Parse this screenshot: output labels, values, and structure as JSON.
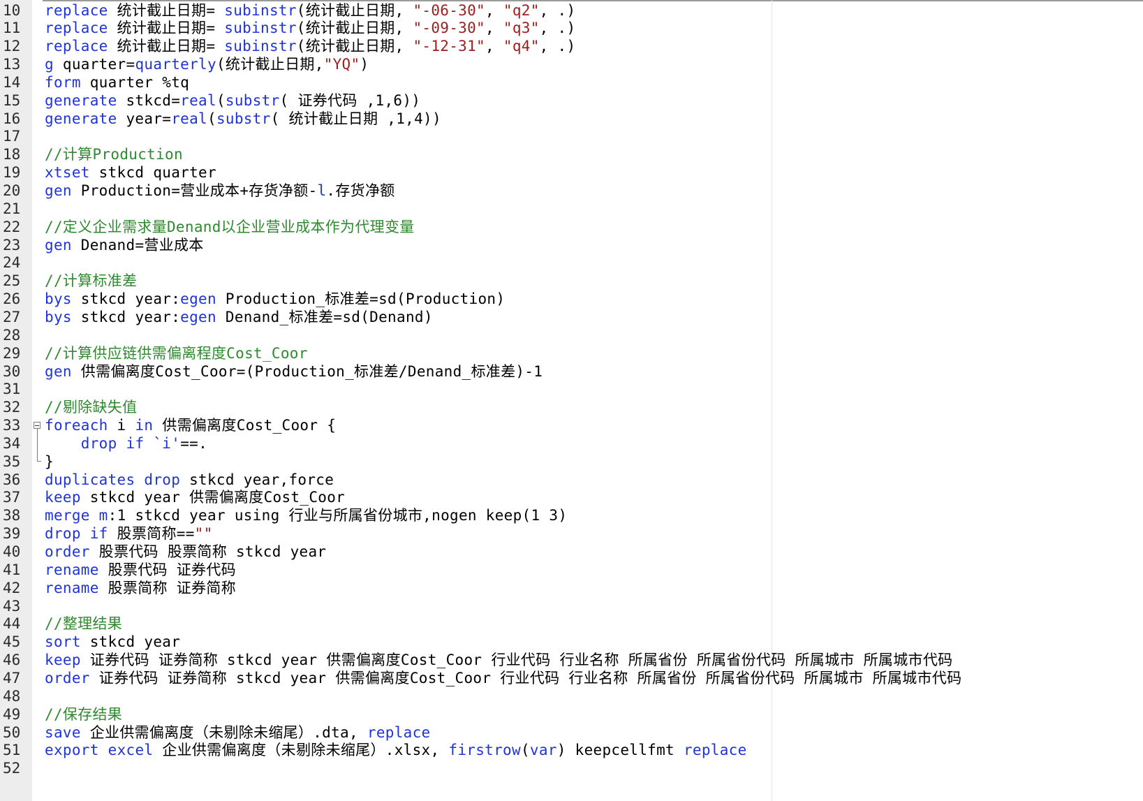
{
  "editor": {
    "first_line_number": 10,
    "lines": [
      {
        "n": "10",
        "tokens": [
          [
            "k",
            "replace"
          ],
          [
            "p",
            " 统计截止日期= "
          ],
          [
            "k",
            "subinstr"
          ],
          [
            "p",
            "(统计截止日期, "
          ],
          [
            "s",
            "\"-06-30\""
          ],
          [
            "p",
            ", "
          ],
          [
            "s",
            "\"q2\""
          ],
          [
            "p",
            ", .)"
          ]
        ]
      },
      {
        "n": "11",
        "tokens": [
          [
            "k",
            "replace"
          ],
          [
            "p",
            " 统计截止日期= "
          ],
          [
            "k",
            "subinstr"
          ],
          [
            "p",
            "(统计截止日期, "
          ],
          [
            "s",
            "\"-09-30\""
          ],
          [
            "p",
            ", "
          ],
          [
            "s",
            "\"q3\""
          ],
          [
            "p",
            ", .)"
          ]
        ]
      },
      {
        "n": "12",
        "tokens": [
          [
            "k",
            "replace"
          ],
          [
            "p",
            " 统计截止日期= "
          ],
          [
            "k",
            "subinstr"
          ],
          [
            "p",
            "(统计截止日期, "
          ],
          [
            "s",
            "\"-12-31\""
          ],
          [
            "p",
            ", "
          ],
          [
            "s",
            "\"q4\""
          ],
          [
            "p",
            ", .)"
          ]
        ]
      },
      {
        "n": "13",
        "tokens": [
          [
            "k",
            "g"
          ],
          [
            "p",
            " quarter="
          ],
          [
            "k",
            "quarterly"
          ],
          [
            "p",
            "(统计截止日期,"
          ],
          [
            "s",
            "\"YQ\""
          ],
          [
            "p",
            ")"
          ]
        ]
      },
      {
        "n": "14",
        "tokens": [
          [
            "k",
            "form"
          ],
          [
            "p",
            " quarter %tq"
          ]
        ]
      },
      {
        "n": "15",
        "tokens": [
          [
            "k",
            "generate"
          ],
          [
            "p",
            " stkcd="
          ],
          [
            "k",
            "real"
          ],
          [
            "p",
            "("
          ],
          [
            "k",
            "substr"
          ],
          [
            "p",
            "( 证券代码 ,1,6))"
          ]
        ]
      },
      {
        "n": "16",
        "tokens": [
          [
            "k",
            "generate"
          ],
          [
            "p",
            " year="
          ],
          [
            "k",
            "real"
          ],
          [
            "p",
            "("
          ],
          [
            "k",
            "substr"
          ],
          [
            "p",
            "( 统计截止日期 ,1,4))"
          ]
        ]
      },
      {
        "n": "17",
        "tokens": []
      },
      {
        "n": "18",
        "tokens": [
          [
            "c",
            "//计算Production"
          ]
        ]
      },
      {
        "n": "19",
        "tokens": [
          [
            "k",
            "xtset"
          ],
          [
            "p",
            " stkcd quarter"
          ]
        ]
      },
      {
        "n": "20",
        "tokens": [
          [
            "k",
            "gen"
          ],
          [
            "p",
            " Production=营业成本+存货净额-"
          ],
          [
            "k",
            "l"
          ],
          [
            "p",
            ".存货净额"
          ]
        ]
      },
      {
        "n": "21",
        "tokens": []
      },
      {
        "n": "22",
        "tokens": [
          [
            "c",
            "//定义企业需求量Denand以企业营业成本作为代理变量"
          ]
        ]
      },
      {
        "n": "23",
        "tokens": [
          [
            "k",
            "gen"
          ],
          [
            "p",
            " Denand=营业成本"
          ]
        ]
      },
      {
        "n": "24",
        "tokens": []
      },
      {
        "n": "25",
        "tokens": [
          [
            "c",
            "//计算标准差"
          ]
        ]
      },
      {
        "n": "26",
        "tokens": [
          [
            "k",
            "bys"
          ],
          [
            "p",
            " stkcd year:"
          ],
          [
            "k",
            "egen"
          ],
          [
            "p",
            " Production_标准差=sd(Production)"
          ]
        ]
      },
      {
        "n": "27",
        "tokens": [
          [
            "k",
            "bys"
          ],
          [
            "p",
            " stkcd year:"
          ],
          [
            "k",
            "egen"
          ],
          [
            "p",
            " Denand_标准差=sd(Denand)"
          ]
        ]
      },
      {
        "n": "28",
        "tokens": []
      },
      {
        "n": "29",
        "tokens": [
          [
            "c",
            "//计算供应链供需偏离程度Cost_Coor"
          ]
        ]
      },
      {
        "n": "30",
        "tokens": [
          [
            "k",
            "gen"
          ],
          [
            "p",
            " 供需偏离度Cost_Coor=(Production_标准差/Denand_标准差)-1"
          ]
        ]
      },
      {
        "n": "31",
        "tokens": []
      },
      {
        "n": "32",
        "tokens": [
          [
            "c",
            "//剔除缺失值"
          ]
        ]
      },
      {
        "n": "33",
        "tokens": [
          [
            "k",
            "foreach"
          ],
          [
            "p",
            " i "
          ],
          [
            "k",
            "in"
          ],
          [
            "p",
            " 供需偏离度Cost_Coor {"
          ]
        ]
      },
      {
        "n": "34",
        "tokens": [
          [
            "p",
            "    "
          ],
          [
            "k",
            "drop if"
          ],
          [
            "p",
            " "
          ],
          [
            "k",
            "`i'"
          ],
          [
            "p",
            "==."
          ]
        ]
      },
      {
        "n": "35",
        "tokens": [
          [
            "p",
            "}"
          ]
        ]
      },
      {
        "n": "36",
        "tokens": [
          [
            "k",
            "duplicates drop"
          ],
          [
            "p",
            " stkcd year,force"
          ]
        ]
      },
      {
        "n": "37",
        "tokens": [
          [
            "k",
            "keep"
          ],
          [
            "p",
            " stkcd year 供需偏离度Cost_Coor"
          ]
        ]
      },
      {
        "n": "38",
        "tokens": [
          [
            "k",
            "merge"
          ],
          [
            "p",
            " "
          ],
          [
            "k",
            "m"
          ],
          [
            "p",
            ":1 stkcd year using 行业与所属省份城市,nogen keep(1 3)"
          ]
        ]
      },
      {
        "n": "39",
        "tokens": [
          [
            "k",
            "drop if"
          ],
          [
            "p",
            " 股票简称=="
          ],
          [
            "s",
            "\"\""
          ]
        ]
      },
      {
        "n": "40",
        "tokens": [
          [
            "k",
            "order"
          ],
          [
            "p",
            " 股票代码 股票简称 stkcd year"
          ]
        ]
      },
      {
        "n": "41",
        "tokens": [
          [
            "k",
            "rename"
          ],
          [
            "p",
            " 股票代码 证券代码"
          ]
        ]
      },
      {
        "n": "42",
        "tokens": [
          [
            "k",
            "rename"
          ],
          [
            "p",
            " 股票简称 证券简称"
          ]
        ]
      },
      {
        "n": "43",
        "tokens": []
      },
      {
        "n": "44",
        "tokens": [
          [
            "c",
            "//整理结果"
          ]
        ]
      },
      {
        "n": "45",
        "tokens": [
          [
            "k",
            "sort"
          ],
          [
            "p",
            " stkcd year"
          ]
        ]
      },
      {
        "n": "46",
        "tokens": [
          [
            "k",
            "keep"
          ],
          [
            "p",
            " 证券代码 证券简称 stkcd year 供需偏离度Cost_Coor 行业代码 行业名称 所属省份 所属省份代码 所属城市 所属城市代码"
          ]
        ]
      },
      {
        "n": "47",
        "tokens": [
          [
            "k",
            "order"
          ],
          [
            "p",
            " 证券代码 证券简称 stkcd year 供需偏离度Cost_Coor 行业代码 行业名称 所属省份 所属省份代码 所属城市 所属城市代码"
          ]
        ]
      },
      {
        "n": "48",
        "tokens": []
      },
      {
        "n": "49",
        "tokens": [
          [
            "c",
            "//保存结果"
          ]
        ]
      },
      {
        "n": "50",
        "tokens": [
          [
            "k",
            "save"
          ],
          [
            "p",
            " 企业供需偏离度（未剔除未缩尾）.dta, "
          ],
          [
            "k",
            "replace"
          ]
        ]
      },
      {
        "n": "51",
        "tokens": [
          [
            "k",
            "export"
          ],
          [
            "p",
            " "
          ],
          [
            "k",
            "excel"
          ],
          [
            "p",
            " 企业供需偏离度（未剔除未缩尾）.xlsx, "
          ],
          [
            "k",
            "firstrow"
          ],
          [
            "p",
            "("
          ],
          [
            "k",
            "var"
          ],
          [
            "p",
            ") keepcellfmt "
          ],
          [
            "k",
            "replace"
          ]
        ]
      },
      {
        "n": "52",
        "tokens": []
      }
    ]
  },
  "colors": {
    "keyword": "#1f33d6",
    "string": "#9b1d1d",
    "comment": "#2f8a2f",
    "plain": "#000000",
    "gutter_bg": "#ededed"
  },
  "icons": {
    "fold_marker": "fold-minus-icon"
  }
}
